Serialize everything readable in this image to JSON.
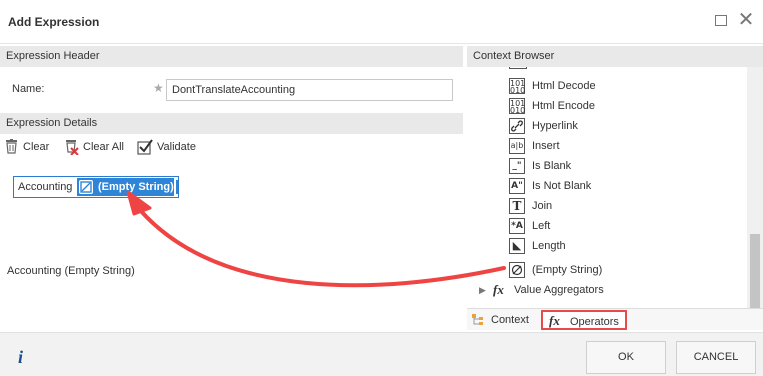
{
  "window": {
    "title": "Add Expression",
    "maximize_icon": "maximize-icon",
    "close_glyph": "✕"
  },
  "expression_header": {
    "title": "Expression Header",
    "name_label": "Name:",
    "required_marker": "★",
    "name_value": "DontTranslateAccounting"
  },
  "expression_details": {
    "title": "Expression Details",
    "toolbar": {
      "clear": "Clear",
      "clear_all": "Clear All",
      "validate": "Validate"
    },
    "editor": {
      "text": "Accounting",
      "chip_label": "(Empty String)"
    },
    "preview": "Accounting (Empty String)"
  },
  "context_browser": {
    "title": "Context Browser",
    "items": [
      {
        "label": "Html Decode",
        "icon": "101\n010"
      },
      {
        "label": "Html Encode",
        "icon": "101\n010"
      },
      {
        "label": "Hyperlink",
        "icon": "🔗"
      },
      {
        "label": "Insert",
        "icon": "a|b"
      },
      {
        "label": "Is Blank",
        "icon": "_\""
      },
      {
        "label": "Is Not Blank",
        "icon": "A\""
      },
      {
        "label": "Join",
        "icon": "T"
      },
      {
        "label": "Left",
        "icon": "*A"
      },
      {
        "label": "Length",
        "icon": "◣"
      },
      {
        "label": "(Empty String)",
        "icon": "⊘"
      }
    ],
    "group": {
      "label": "Value Aggregators",
      "fx": "fx"
    },
    "tabs": {
      "context": "Context",
      "operators": "Operators",
      "fx": "fx"
    }
  },
  "footer": {
    "info": "i",
    "ok": "OK",
    "cancel": "CANCEL"
  },
  "colors": {
    "accent": "#2e85d8",
    "highlight": "#e84a4a",
    "panel": "#e9e9e9"
  }
}
